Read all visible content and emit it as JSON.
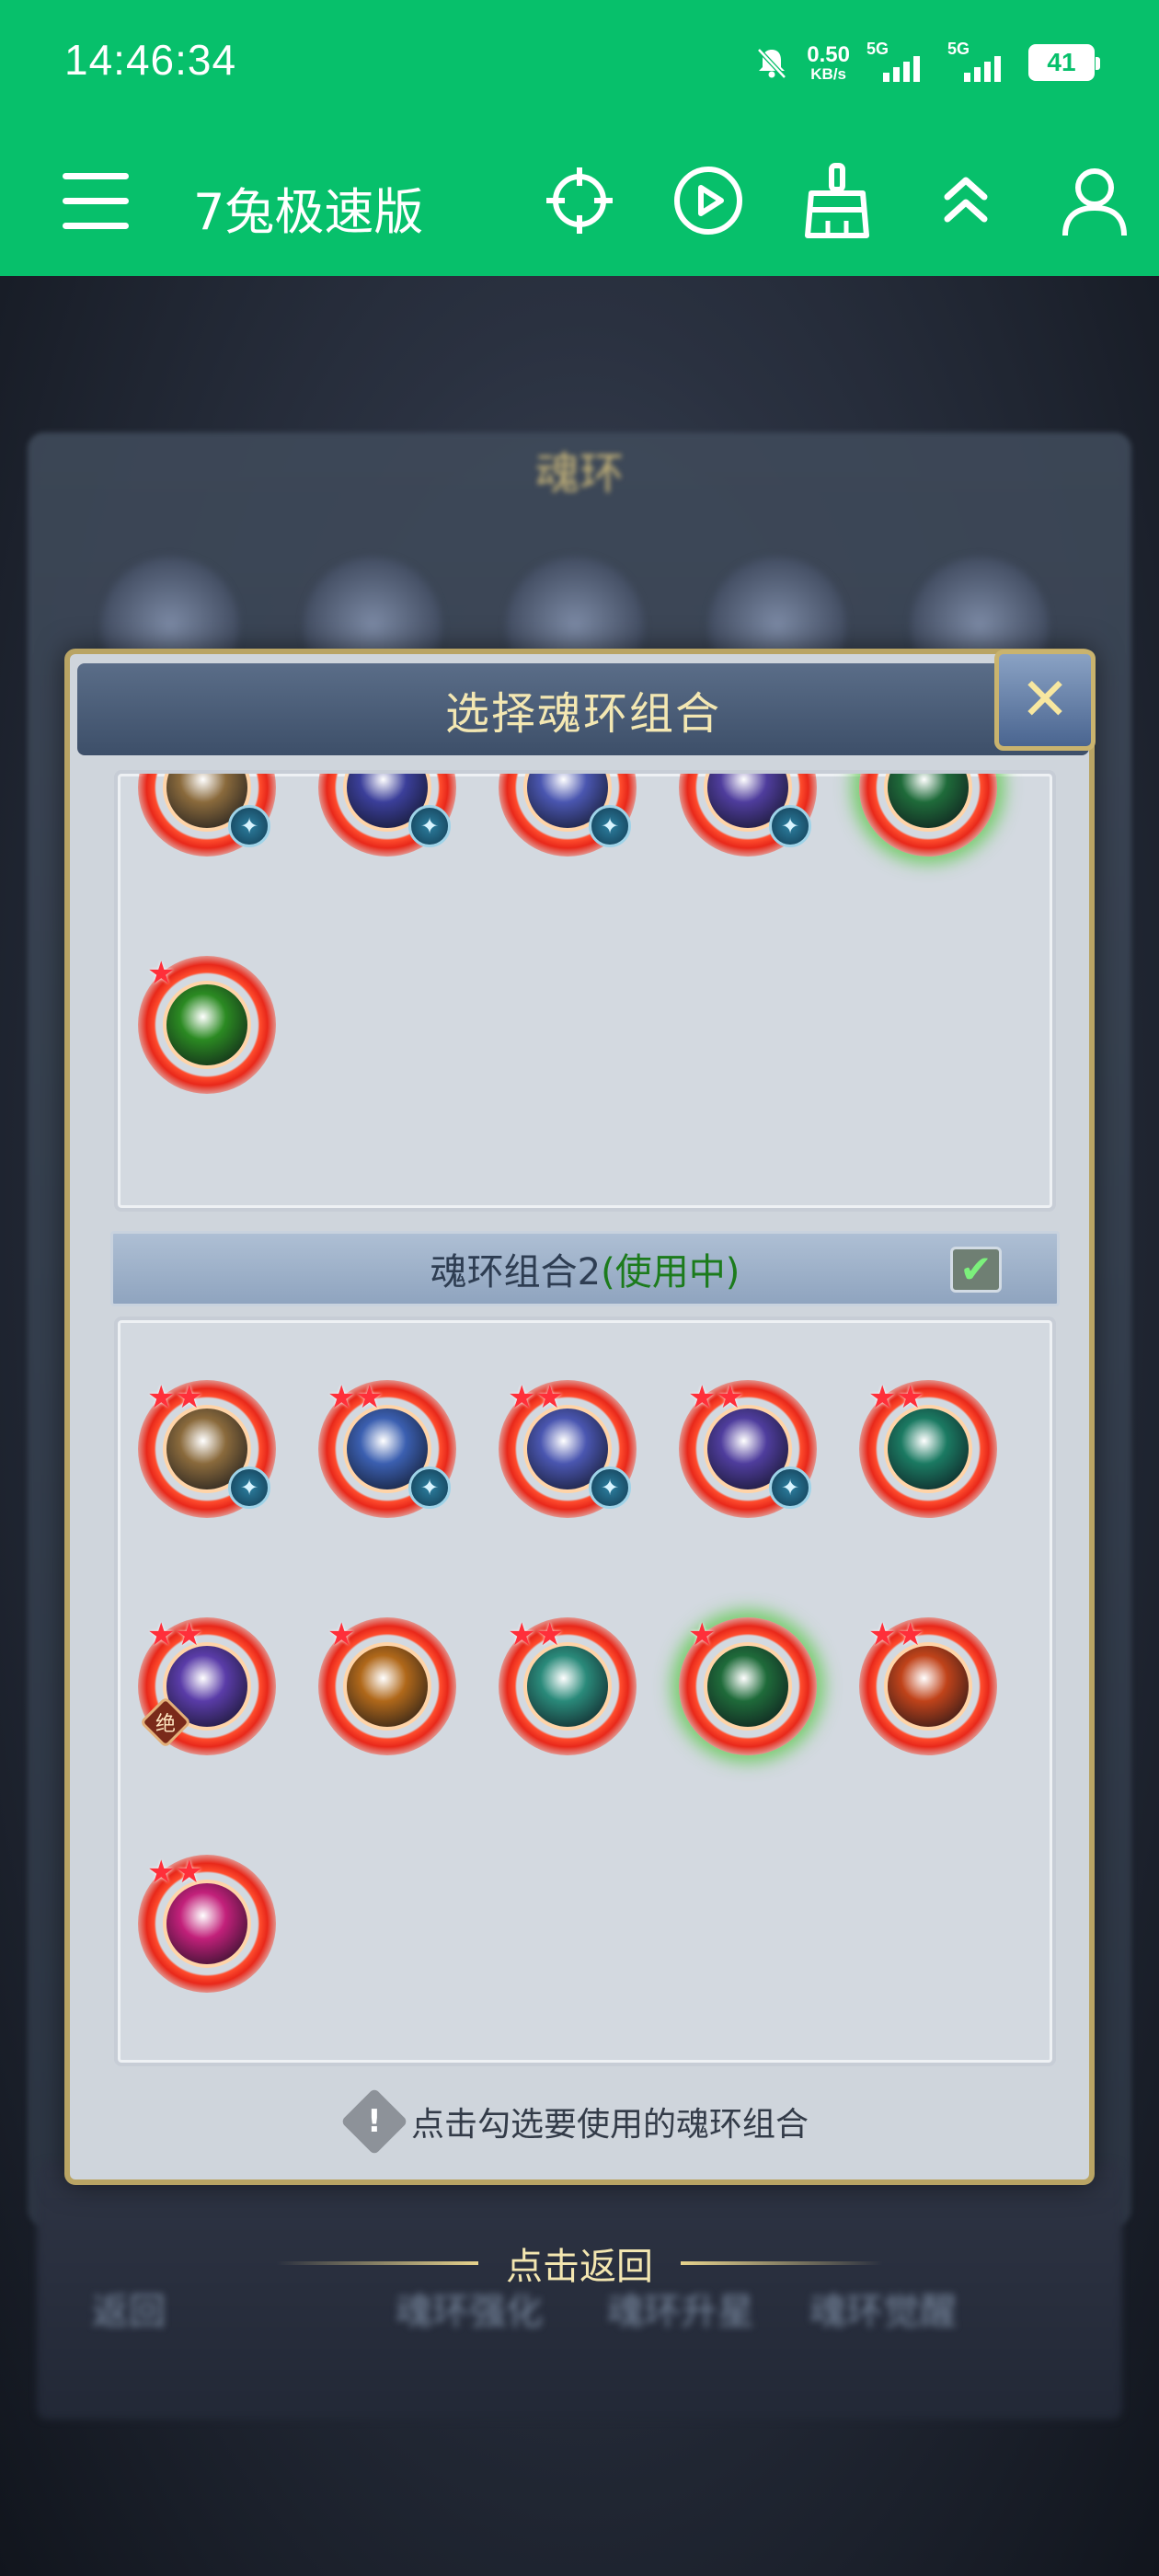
{
  "status_bar": {
    "time": "14:46:34",
    "net_speed_value": "0.50",
    "net_speed_unit": "KB/s",
    "sim1_label": "5G",
    "sim2_label": "5G",
    "battery": "41"
  },
  "app_bar": {
    "title": "7兔极速版",
    "icons": [
      "menu-icon",
      "crosshair-icon",
      "play-icon",
      "broom-icon",
      "double-chevron-up-icon",
      "user-icon"
    ]
  },
  "background": {
    "panel_title": "魂环",
    "bottom_buttons": [
      "返回",
      "魂环强化",
      "魂环升星",
      "魂环觉醒"
    ]
  },
  "dialog": {
    "title": "选择魂环组合",
    "close_label": "✕",
    "group1": {
      "rings": [
        {
          "color": "#8a6a3c",
          "badge": true
        },
        {
          "color": "#3b3f9a",
          "badge": true
        },
        {
          "color": "#4a56b0",
          "badge": true
        },
        {
          "color": "#4f3d9d",
          "badge": true
        },
        {
          "color": "#1f6b3a",
          "glow": true
        },
        {
          "color": "#2b8a22",
          "stars": "★"
        }
      ]
    },
    "group2": {
      "title": "魂环组合2",
      "status": "(使用中)",
      "checked": true,
      "check_mark": "✔",
      "rings": [
        {
          "color": "#8a6a3c",
          "stars": "★★",
          "badge": true
        },
        {
          "color": "#3b5fb0",
          "stars": "★★",
          "badge": true
        },
        {
          "color": "#4a56b0",
          "stars": "★★",
          "badge": true
        },
        {
          "color": "#4f3d9d",
          "stars": "★★",
          "badge": true
        },
        {
          "color": "#1b7a62",
          "stars": "★★"
        },
        {
          "color": "#5a3ca8",
          "stars": "★★",
          "jue": "绝"
        },
        {
          "color": "#b0681a",
          "stars": "★"
        },
        {
          "color": "#2a8a7a",
          "stars": "★★"
        },
        {
          "color": "#1f6b3a",
          "stars": "★",
          "glow": true
        },
        {
          "color": "#c0431a",
          "stars": "★★"
        },
        {
          "color": "#c2207a",
          "stars": "★★"
        }
      ]
    },
    "hint_icon": "!",
    "hint": "点击勾选要使用的魂环组合"
  },
  "back_hint": "点击返回"
}
